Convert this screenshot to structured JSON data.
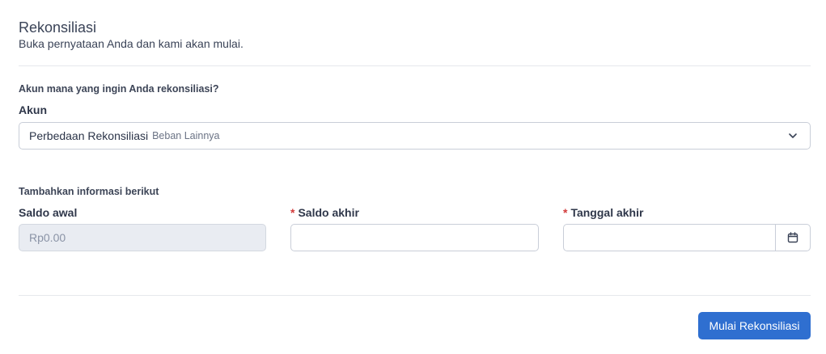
{
  "header": {
    "title": "Rekonsiliasi",
    "subtitle": "Buka pernyataan Anda dan kami akan mulai."
  },
  "account_section": {
    "question": "Akun mana yang ingin Anda rekonsiliasi?",
    "label": "Akun",
    "selected_main": "Perbedaan Rekonsiliasi",
    "selected_sub": "Beban Lainnya"
  },
  "info_section": {
    "heading": "Tambahkan informasi berikut",
    "opening_balance_label": "Saldo awal",
    "opening_balance_value": "Rp0.00",
    "closing_balance_label": "Saldo akhir",
    "closing_balance_value": "",
    "end_date_label": "Tanggal akhir",
    "end_date_value": "",
    "required_mark": "*"
  },
  "actions": {
    "start_label": "Mulai Rekonsiliasi"
  },
  "icons": {
    "dropdown": "chevron-down-icon",
    "date": "calendar-icon"
  },
  "colors": {
    "primary": "#2f6fd0",
    "required": "#d23b3b",
    "disabled_bg": "#e9ecf2"
  }
}
